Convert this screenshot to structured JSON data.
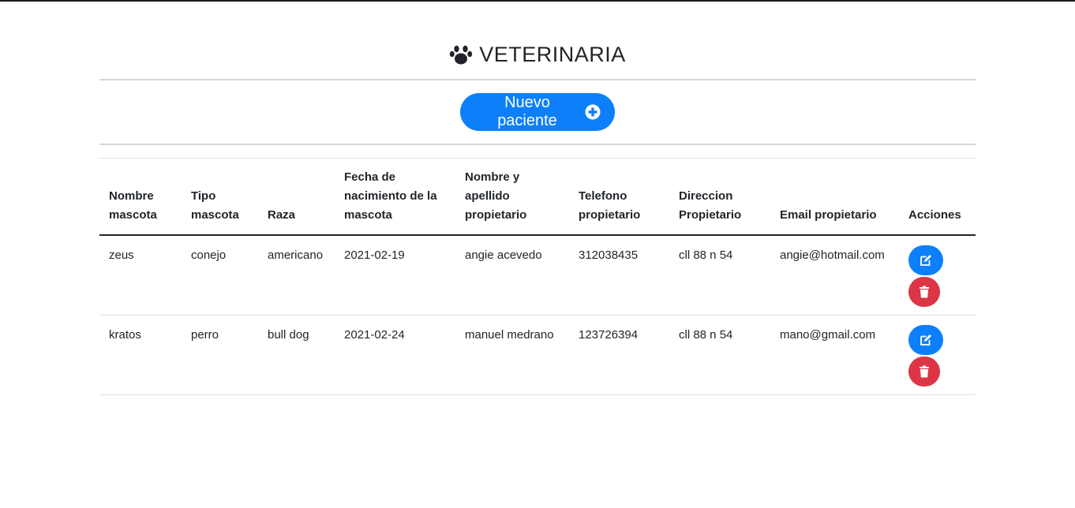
{
  "header": {
    "title": "VETERINARIA",
    "icon": "paw-icon"
  },
  "toolbar": {
    "new_button_label": "Nuevo paciente",
    "new_button_icon": "plus-circle-icon"
  },
  "colors": {
    "primary": "#0d7ffb",
    "danger": "#dc3545"
  },
  "table": {
    "columns": [
      "Nombre mascota",
      "Tipo mascota",
      "Raza",
      "Fecha de nacimiento de la mascota",
      "Nombre y apellido propietario",
      "Telefono propietario",
      "Direccion Propietario",
      "Email propietario",
      "Acciones"
    ],
    "rows": [
      {
        "nombre": "zeus",
        "tipo": "conejo",
        "raza": "americano",
        "fecha": "2021-02-19",
        "propietario": "angie acevedo",
        "telefono": "312038435",
        "direccion": "cll 88 n 54",
        "email": "angie@hotmail.com"
      },
      {
        "nombre": "kratos",
        "tipo": "perro",
        "raza": "bull dog",
        "fecha": "2021-02-24",
        "propietario": "manuel medrano",
        "telefono": "123726394",
        "direccion": "cll 88 n 54",
        "email": "mano@gmail.com"
      }
    ],
    "row_actions": {
      "edit_icon": "edit-icon",
      "delete_icon": "trash-icon"
    }
  }
}
